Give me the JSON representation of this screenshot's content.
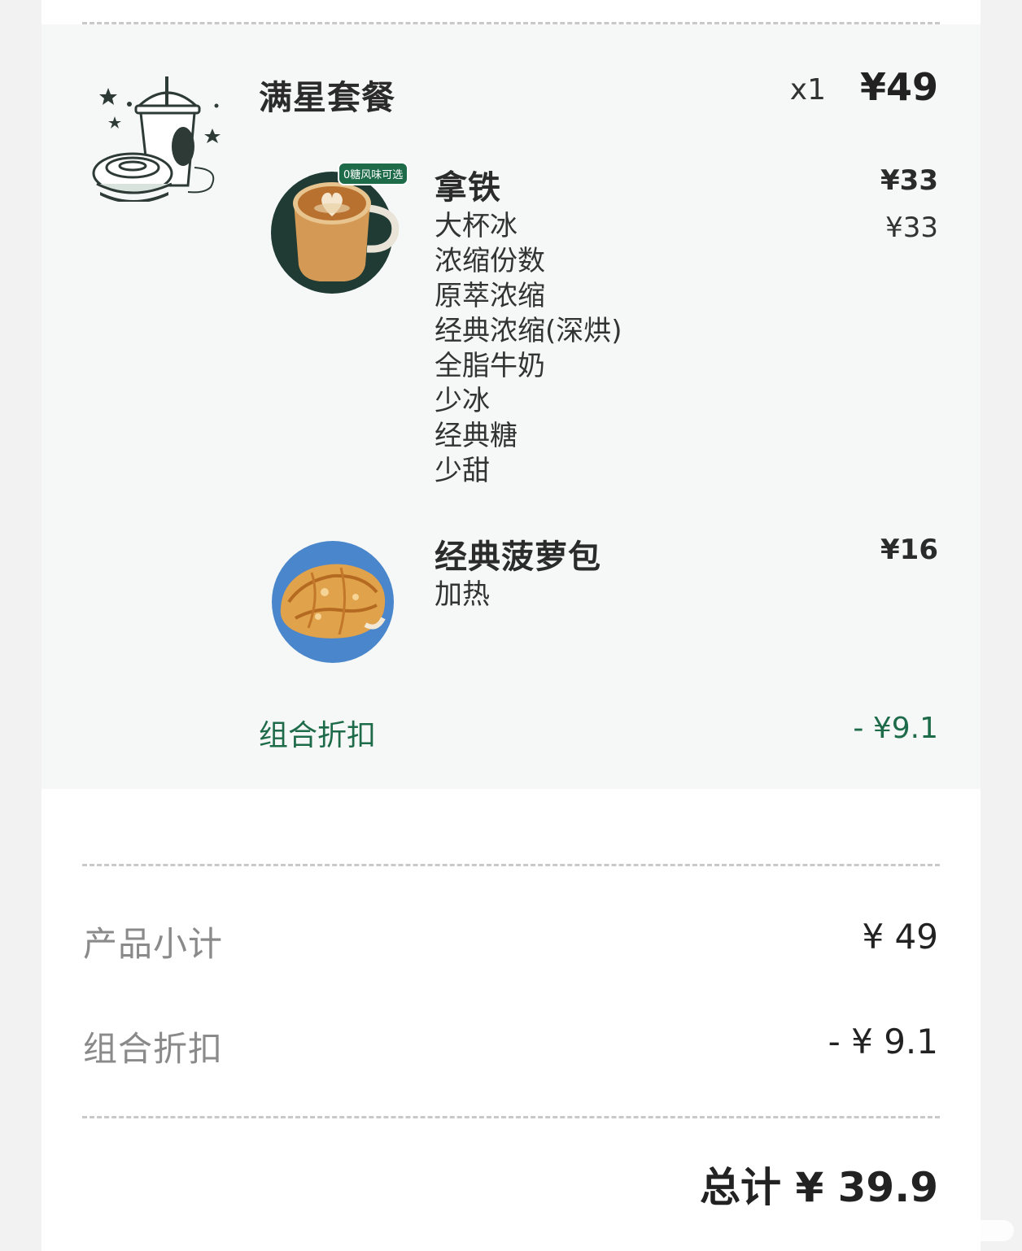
{
  "order": {
    "set": {
      "name": "满星套餐",
      "qty": "x1",
      "price": "¥49",
      "icon": "meal-combo-illustration"
    },
    "items": [
      {
        "name": "拿铁",
        "price": "¥33",
        "badge": "0糖风味可选",
        "options": [
          "大杯冰",
          "浓缩份数",
          "原萃浓缩",
          "经典浓缩(深烘)",
          "全脂牛奶",
          "少冰",
          "经典糖",
          "少甜"
        ],
        "option_price": "¥33"
      },
      {
        "name": "经典菠萝包",
        "price": "¥16",
        "options": [
          "加热"
        ]
      }
    ],
    "combo_discount": {
      "label": "组合折扣",
      "value": "- ¥9.1"
    }
  },
  "summary": {
    "subtotal_label": "产品小计",
    "subtotal_value": "¥ 49",
    "discount_label": "组合折扣",
    "discount_value": "- ¥ 9.1",
    "total_label": "总计",
    "total_value": "¥ 39.9"
  },
  "colors": {
    "accent_green": "#1e6b4a",
    "latte_circle": "#1f3b33",
    "bun_circle": "#4a86cc"
  }
}
